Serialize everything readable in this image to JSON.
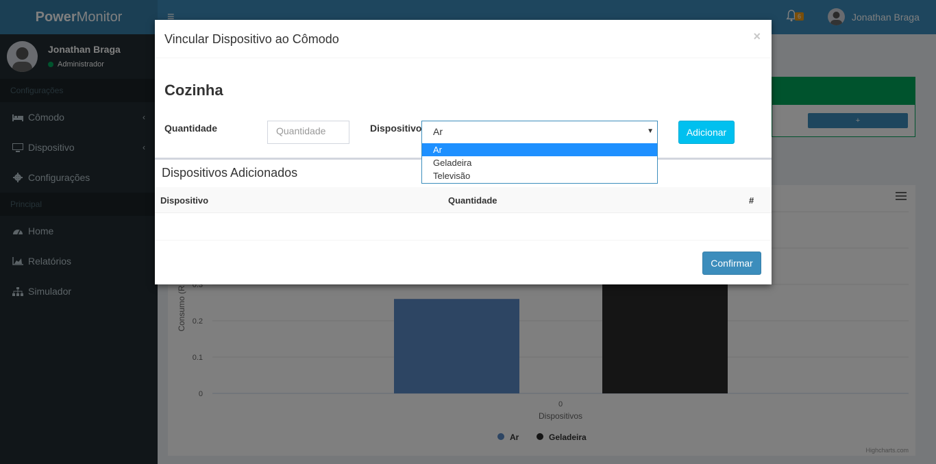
{
  "brand": {
    "bold": "Power",
    "light": "Monitor"
  },
  "navbar": {
    "menu_icon": "hamburger-icon",
    "notification_count": "6",
    "user_name": "Jonathan Braga"
  },
  "sidebar": {
    "user_name": "Jonathan Braga",
    "user_role": "Administrador",
    "section_config": "Configurações",
    "section_main": "Principal",
    "items": [
      {
        "label": "Cômodo",
        "icon": "bed-icon"
      },
      {
        "label": "Dispositivo",
        "icon": "monitor-icon"
      },
      {
        "label": "Configurações",
        "icon": "gear-icon"
      },
      {
        "label": "Home",
        "icon": "dashboard-icon"
      },
      {
        "label": "Relatórios",
        "icon": "area-chart-icon"
      },
      {
        "label": "Simulador",
        "icon": "sitemap-icon"
      }
    ]
  },
  "background": {
    "plus_label": "+"
  },
  "chart_data": {
    "type": "bar",
    "categories": [
      "0"
    ],
    "series": [
      {
        "name": "Ar",
        "values": [
          0.26
        ],
        "color": "#5b8ac7"
      },
      {
        "name": "Geladeira",
        "values": [
          0.31
        ],
        "color": "#2b2b2b"
      }
    ],
    "xlabel": "Dispositivos",
    "ylabel": "Consumo (R",
    "y_ticks": [
      "0",
      "0.1",
      "0.2",
      "0.3"
    ],
    "credit": "Highcharts.com",
    "legend_position": "bottom"
  },
  "modal": {
    "title": "Vincular Dispositivo ao Cômodo",
    "close": "×",
    "room": "Cozinha",
    "quantity_label": "Quantidade",
    "quantity_placeholder": "Quantidade",
    "device_label": "Dispositivo",
    "device_selected": "Ar",
    "device_options": [
      "Ar",
      "Geladeira",
      "Televisão"
    ],
    "add_button": "Adicionar",
    "added_title": "Dispositivos Adicionados",
    "table_headers": [
      "Dispositivo",
      "Quantidade",
      "#"
    ],
    "confirm_button": "Confirmar"
  }
}
